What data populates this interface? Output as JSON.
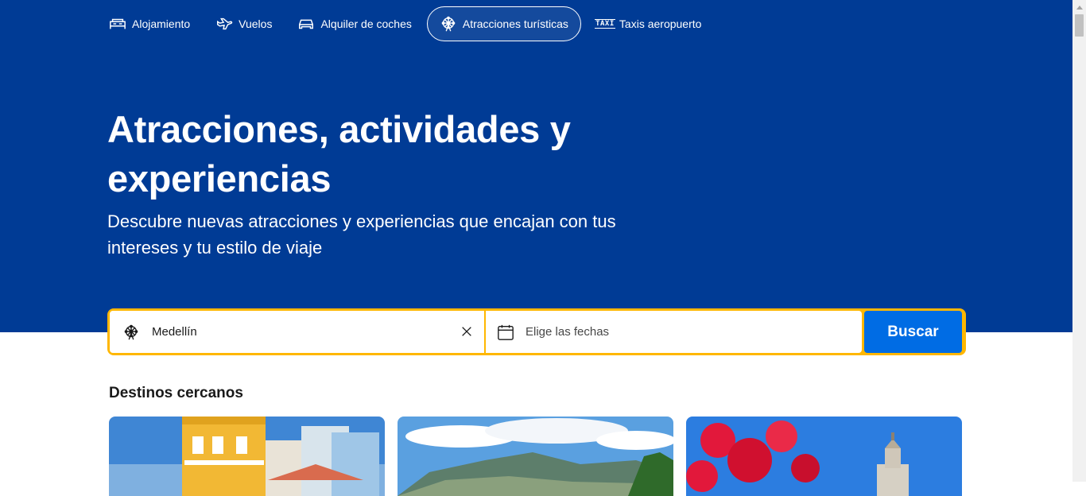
{
  "nav": {
    "items": [
      {
        "label": "Alojamiento",
        "icon": "bed-icon",
        "active": false
      },
      {
        "label": "Vuelos",
        "icon": "plane-icon",
        "active": false
      },
      {
        "label": "Alquiler de coches",
        "icon": "car-icon",
        "active": false
      },
      {
        "label": "Atracciones turísticas",
        "icon": "ferris-wheel-icon",
        "active": true
      },
      {
        "label": "Taxis aeropuerto",
        "icon": "taxi-icon",
        "active": false
      }
    ],
    "taxi_glyph": "TAXI"
  },
  "hero": {
    "title": "Atracciones, actividades y experiencias",
    "subtitle": "Descubre nuevas atracciones y experiencias que encajan con tus intereses y tu estilo de viaje"
  },
  "search": {
    "destination_value": "Medellín",
    "dates_placeholder": "Elige las fechas",
    "button_label": "Buscar"
  },
  "nearby": {
    "title": "Destinos cercanos",
    "cards": [
      {
        "image": "colonial-street-photo"
      },
      {
        "image": "mountain-valley-photo"
      },
      {
        "image": "red-blossoms-church-photo"
      }
    ]
  },
  "colors": {
    "brand_blue": "#003b95",
    "search_border": "#ffb700",
    "button_blue": "#006ce4"
  }
}
